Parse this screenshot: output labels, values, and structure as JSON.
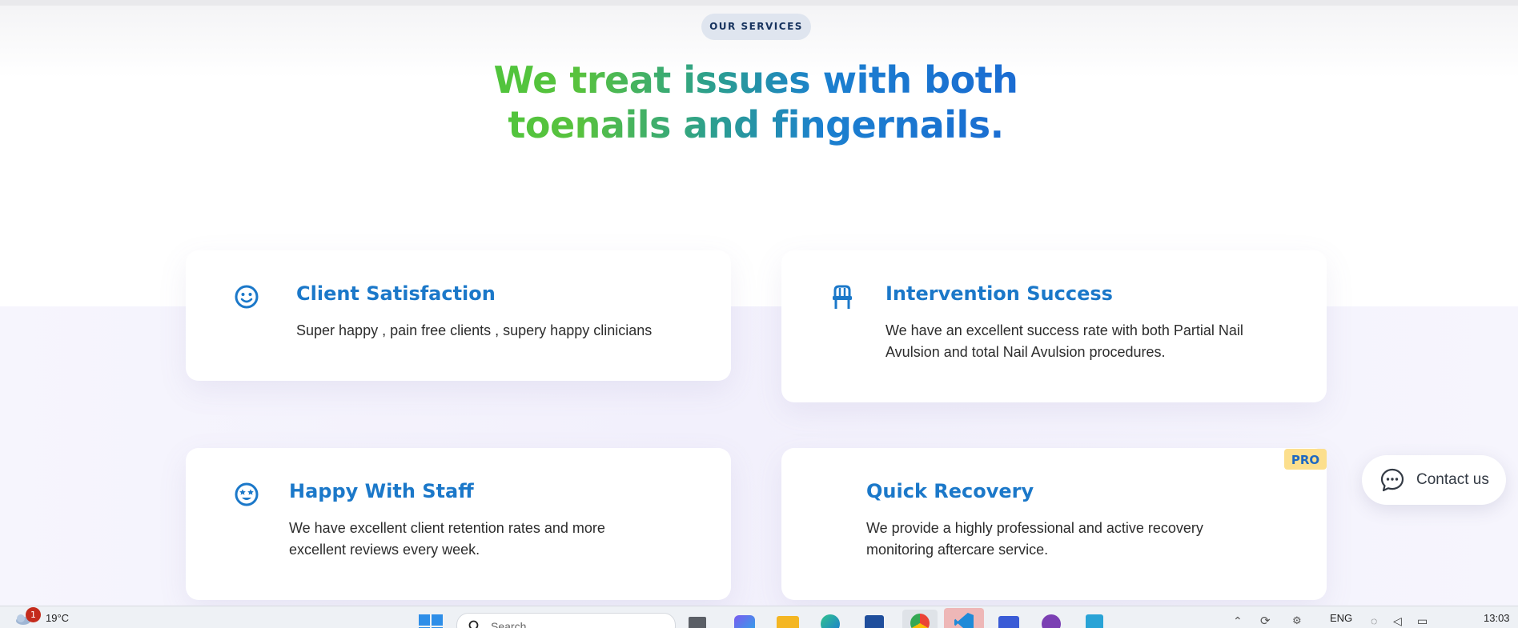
{
  "hero": {
    "badge": "OUR SERVICES",
    "headline": "We treat issues with both toenails and fingernails."
  },
  "colors": {
    "accent_blue": "#1b78c9",
    "gradient_green": "#4fc53c",
    "gradient_blue": "#1a6ad2",
    "badge_bg": "#dfe5ef",
    "pro_bg": "#fcdf8d"
  },
  "services": [
    {
      "icon": "smile-icon",
      "title": "Client Satisfaction",
      "text": "Super happy , pain free clients , supery happy clinicians"
    },
    {
      "icon": "chair-icon",
      "title": "Intervention Success",
      "text": "We have an excellent success rate with both Partial Nail Avulsion and total Nail Avulsion procedures."
    },
    {
      "icon": "star-eyes-smile-icon",
      "title": "Happy With Staff",
      "text": "We have excellent client retention rates and more excellent reviews every week."
    },
    {
      "icon": "",
      "title": "Quick Recovery",
      "text": "We provide a highly professional and active recovery monitoring aftercare service.",
      "badge": "PRO"
    }
  ],
  "contact": {
    "label": "Contact us",
    "icon": "chat-bubble-icon"
  },
  "taskbar": {
    "weather_temp": "19°C",
    "weather_notifications": "1",
    "search_placeholder": "Search",
    "language": "ENG",
    "time": "13:03"
  }
}
